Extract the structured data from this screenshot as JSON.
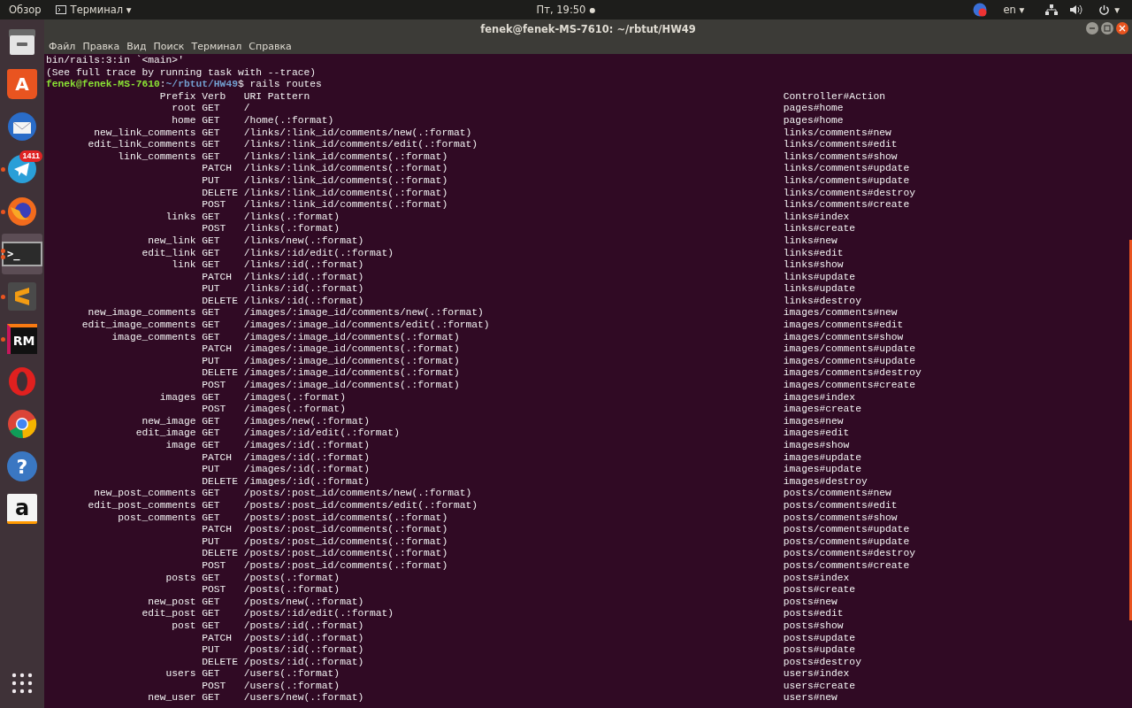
{
  "top_bar": {
    "activities": "Обзор",
    "app_menu": {
      "label": "Терминал",
      "caret": "▾"
    },
    "clock": "Пт, 19:50",
    "clock_dot": "●",
    "language": {
      "label": "en",
      "caret": "▾"
    },
    "power_caret": "▾"
  },
  "dock": [
    {
      "kind": "files",
      "running": false,
      "selected": false
    },
    {
      "kind": "store",
      "glyph": "A",
      "running": false,
      "selected": false
    },
    {
      "kind": "mail",
      "running": false,
      "selected": false
    },
    {
      "kind": "messenger",
      "badge": "1411",
      "running": true,
      "several_windows": false,
      "selected": false
    },
    {
      "kind": "browser_fox",
      "running": true,
      "several_windows": false,
      "selected": false
    },
    {
      "kind": "terminal",
      "glyph": ">_",
      "running": true,
      "several_windows": true,
      "selected": true
    },
    {
      "kind": "editor",
      "running": true,
      "several_windows": false,
      "selected": false
    },
    {
      "kind": "ide",
      "glyph": "RM",
      "running": true,
      "several_windows": false,
      "selected": false
    },
    {
      "kind": "browser_o",
      "running": false,
      "selected": false
    },
    {
      "kind": "browser_chrome",
      "running": false,
      "selected": false
    },
    {
      "kind": "help",
      "glyph": "?",
      "running": false,
      "selected": false
    },
    {
      "kind": "shop",
      "glyph": "a",
      "running": false,
      "selected": false
    }
  ],
  "window": {
    "title": "fenek@fenek-MS-7610: ~/rbtut/HW49",
    "menu": [
      "Файл",
      "Правка",
      "Вид",
      "Поиск",
      "Терминал",
      "Справка"
    ]
  },
  "terminal": {
    "lines": [
      {
        "kind": "text",
        "text": "bin/rails:3:in `<main>'"
      },
      {
        "kind": "text",
        "text": "(See full trace by running task with --trace)"
      },
      {
        "kind": "prompt",
        "user_host": "fenek@fenek-MS-7610",
        "separator": ":",
        "path": "~/rbtut/HW49",
        "command": "$ rails routes"
      },
      {
        "kind": "header",
        "prefix": "Prefix",
        "verb": "Verb",
        "uri": "URI Pattern",
        "action": "Controller#Action"
      },
      {
        "kind": "route",
        "prefix": "root",
        "verb": "GET",
        "uri": "/",
        "action": "pages#home"
      },
      {
        "kind": "route",
        "prefix": "home",
        "verb": "GET",
        "uri": "/home(.:format)",
        "action": "pages#home"
      },
      {
        "kind": "route",
        "prefix": "new_link_comments",
        "verb": "GET",
        "uri": "/links/:link_id/comments/new(.:format)",
        "action": "links/comments#new"
      },
      {
        "kind": "route",
        "prefix": "edit_link_comments",
        "verb": "GET",
        "uri": "/links/:link_id/comments/edit(.:format)",
        "action": "links/comments#edit"
      },
      {
        "kind": "route",
        "prefix": "link_comments",
        "verb": "GET",
        "uri": "/links/:link_id/comments(.:format)",
        "action": "links/comments#show"
      },
      {
        "kind": "route",
        "verb": "PATCH",
        "uri": "/links/:link_id/comments(.:format)",
        "action": "links/comments#update"
      },
      {
        "kind": "route",
        "verb": "PUT",
        "uri": "/links/:link_id/comments(.:format)",
        "action": "links/comments#update"
      },
      {
        "kind": "route",
        "verb": "DELETE",
        "uri": "/links/:link_id/comments(.:format)",
        "action": "links/comments#destroy"
      },
      {
        "kind": "route",
        "verb": "POST",
        "uri": "/links/:link_id/comments(.:format)",
        "action": "links/comments#create"
      },
      {
        "kind": "route",
        "prefix": "links",
        "verb": "GET",
        "uri": "/links(.:format)",
        "action": "links#index"
      },
      {
        "kind": "route",
        "verb": "POST",
        "uri": "/links(.:format)",
        "action": "links#create"
      },
      {
        "kind": "route",
        "prefix": "new_link",
        "verb": "GET",
        "uri": "/links/new(.:format)",
        "action": "links#new"
      },
      {
        "kind": "route",
        "prefix": "edit_link",
        "verb": "GET",
        "uri": "/links/:id/edit(.:format)",
        "action": "links#edit"
      },
      {
        "kind": "route",
        "prefix": "link",
        "verb": "GET",
        "uri": "/links/:id(.:format)",
        "action": "links#show"
      },
      {
        "kind": "route",
        "verb": "PATCH",
        "uri": "/links/:id(.:format)",
        "action": "links#update"
      },
      {
        "kind": "route",
        "verb": "PUT",
        "uri": "/links/:id(.:format)",
        "action": "links#update"
      },
      {
        "kind": "route",
        "verb": "DELETE",
        "uri": "/links/:id(.:format)",
        "action": "links#destroy"
      },
      {
        "kind": "route",
        "prefix": "new_image_comments",
        "verb": "GET",
        "uri": "/images/:image_id/comments/new(.:format)",
        "action": "images/comments#new"
      },
      {
        "kind": "route",
        "prefix": "edit_image_comments",
        "verb": "GET",
        "uri": "/images/:image_id/comments/edit(.:format)",
        "action": "images/comments#edit"
      },
      {
        "kind": "route",
        "prefix": "image_comments",
        "verb": "GET",
        "uri": "/images/:image_id/comments(.:format)",
        "action": "images/comments#show"
      },
      {
        "kind": "route",
        "verb": "PATCH",
        "uri": "/images/:image_id/comments(.:format)",
        "action": "images/comments#update"
      },
      {
        "kind": "route",
        "verb": "PUT",
        "uri": "/images/:image_id/comments(.:format)",
        "action": "images/comments#update"
      },
      {
        "kind": "route",
        "verb": "DELETE",
        "uri": "/images/:image_id/comments(.:format)",
        "action": "images/comments#destroy"
      },
      {
        "kind": "route",
        "verb": "POST",
        "uri": "/images/:image_id/comments(.:format)",
        "action": "images/comments#create"
      },
      {
        "kind": "route",
        "prefix": "images",
        "verb": "GET",
        "uri": "/images(.:format)",
        "action": "images#index"
      },
      {
        "kind": "route",
        "verb": "POST",
        "uri": "/images(.:format)",
        "action": "images#create"
      },
      {
        "kind": "route",
        "prefix": "new_image",
        "verb": "GET",
        "uri": "/images/new(.:format)",
        "action": "images#new"
      },
      {
        "kind": "route",
        "prefix": "edit_image",
        "verb": "GET",
        "uri": "/images/:id/edit(.:format)",
        "action": "images#edit"
      },
      {
        "kind": "route",
        "prefix": "image",
        "verb": "GET",
        "uri": "/images/:id(.:format)",
        "action": "images#show"
      },
      {
        "kind": "route",
        "verb": "PATCH",
        "uri": "/images/:id(.:format)",
        "action": "images#update"
      },
      {
        "kind": "route",
        "verb": "PUT",
        "uri": "/images/:id(.:format)",
        "action": "images#update"
      },
      {
        "kind": "route",
        "verb": "DELETE",
        "uri": "/images/:id(.:format)",
        "action": "images#destroy"
      },
      {
        "kind": "route",
        "prefix": "new_post_comments",
        "verb": "GET",
        "uri": "/posts/:post_id/comments/new(.:format)",
        "action": "posts/comments#new"
      },
      {
        "kind": "route",
        "prefix": "edit_post_comments",
        "verb": "GET",
        "uri": "/posts/:post_id/comments/edit(.:format)",
        "action": "posts/comments#edit"
      },
      {
        "kind": "route",
        "prefix": "post_comments",
        "verb": "GET",
        "uri": "/posts/:post_id/comments(.:format)",
        "action": "posts/comments#show"
      },
      {
        "kind": "route",
        "verb": "PATCH",
        "uri": "/posts/:post_id/comments(.:format)",
        "action": "posts/comments#update"
      },
      {
        "kind": "route",
        "verb": "PUT",
        "uri": "/posts/:post_id/comments(.:format)",
        "action": "posts/comments#update"
      },
      {
        "kind": "route",
        "verb": "DELETE",
        "uri": "/posts/:post_id/comments(.:format)",
        "action": "posts/comments#destroy"
      },
      {
        "kind": "route",
        "verb": "POST",
        "uri": "/posts/:post_id/comments(.:format)",
        "action": "posts/comments#create"
      },
      {
        "kind": "route",
        "prefix": "posts",
        "verb": "GET",
        "uri": "/posts(.:format)",
        "action": "posts#index"
      },
      {
        "kind": "route",
        "verb": "POST",
        "uri": "/posts(.:format)",
        "action": "posts#create"
      },
      {
        "kind": "route",
        "prefix": "new_post",
        "verb": "GET",
        "uri": "/posts/new(.:format)",
        "action": "posts#new"
      },
      {
        "kind": "route",
        "prefix": "edit_post",
        "verb": "GET",
        "uri": "/posts/:id/edit(.:format)",
        "action": "posts#edit"
      },
      {
        "kind": "route",
        "prefix": "post",
        "verb": "GET",
        "uri": "/posts/:id(.:format)",
        "action": "posts#show"
      },
      {
        "kind": "route",
        "verb": "PATCH",
        "uri": "/posts/:id(.:format)",
        "action": "posts#update"
      },
      {
        "kind": "route",
        "verb": "PUT",
        "uri": "/posts/:id(.:format)",
        "action": "posts#update"
      },
      {
        "kind": "route",
        "verb": "DELETE",
        "uri": "/posts/:id(.:format)",
        "action": "posts#destroy"
      },
      {
        "kind": "route",
        "prefix": "users",
        "verb": "GET",
        "uri": "/users(.:format)",
        "action": "users#index"
      },
      {
        "kind": "route",
        "verb": "POST",
        "uri": "/users(.:format)",
        "action": "users#create"
      },
      {
        "kind": "route",
        "prefix": "new_user",
        "verb": "GET",
        "uri": "/users/new(.:format)",
        "action": "users#new"
      }
    ]
  }
}
